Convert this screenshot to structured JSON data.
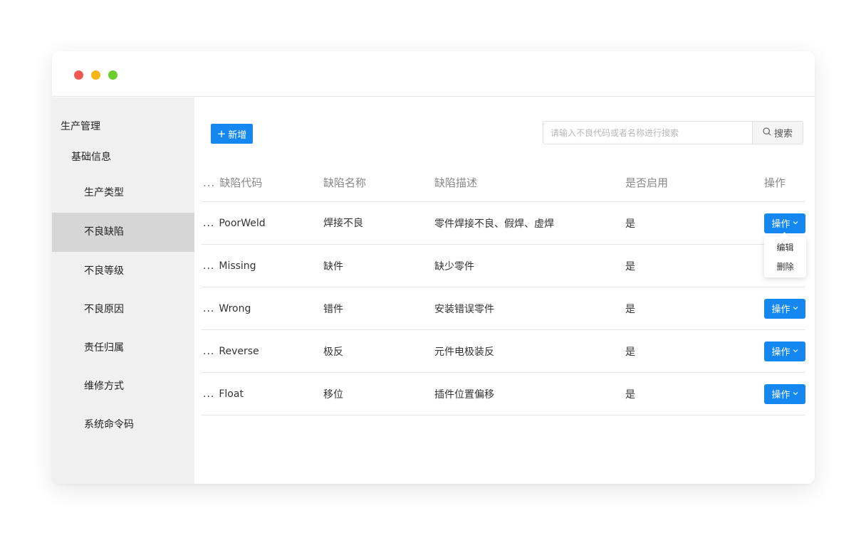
{
  "colors": {
    "primary": "#1487f0",
    "close": "#f15751",
    "minimize": "#f5b515",
    "maximize": "#6ccd2d",
    "sidebar_bg": "#f0f0f0",
    "sidebar_active": "#d6d6d6"
  },
  "sidebar": {
    "group": "生产管理",
    "subgroup": "基础信息",
    "items": [
      {
        "label": "生产类型",
        "active": false
      },
      {
        "label": "不良缺陷",
        "active": true
      },
      {
        "label": "不良等级",
        "active": false
      },
      {
        "label": "不良原因",
        "active": false
      },
      {
        "label": "责任归属",
        "active": false
      },
      {
        "label": "维修方式",
        "active": false
      },
      {
        "label": "系统命令码",
        "active": false
      }
    ]
  },
  "toolbar": {
    "add_icon": "plus-icon",
    "add_label": "新增",
    "search_placeholder": "请输入不良代码或者名称进行搜索",
    "search_icon": "search-icon",
    "search_label": "搜索"
  },
  "table": {
    "ellipsis": "...",
    "headers": [
      "缺陷代码",
      "缺陷名称",
      "缺陷描述",
      "是否启用",
      "操作"
    ],
    "rows": [
      {
        "code": "PoorWeld",
        "name": "焊接不良",
        "desc": "零件焊接不良、假焊、虚焊",
        "enabled": "是",
        "action": "操作"
      },
      {
        "code": "Missing",
        "name": "缺件",
        "desc": "缺少零件",
        "enabled": "是",
        "action": "操作"
      },
      {
        "code": "Wrong",
        "name": "错件",
        "desc": "安装错误零件",
        "enabled": "是",
        "action": "操作"
      },
      {
        "code": "Reverse",
        "name": "极反",
        "desc": "元件电极装反",
        "enabled": "是",
        "action": "操作"
      },
      {
        "code": "Float",
        "name": "移位",
        "desc": "插件位置偏移",
        "enabled": "是",
        "action": "操作"
      }
    ]
  },
  "dropdown": {
    "items": [
      "编辑",
      "删除"
    ]
  }
}
